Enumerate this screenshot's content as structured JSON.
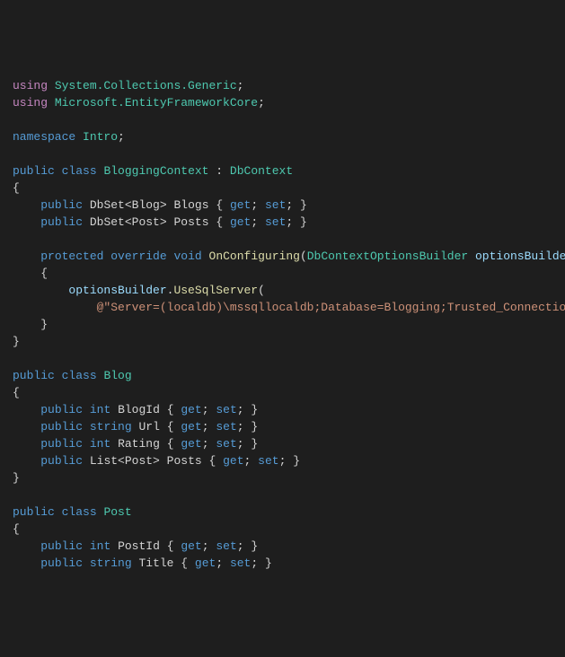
{
  "code": {
    "l1": {
      "using": "using",
      "ns": "System.Collections.Generic",
      "semi": ";"
    },
    "l2": {
      "using": "using",
      "ns": "Microsoft.EntityFrameworkCore",
      "semi": ";"
    },
    "l4": {
      "kw": "namespace",
      "name": "Intro",
      "semi": ";"
    },
    "l6": {
      "pub": "public",
      "cls": "class",
      "name": "BloggingContext",
      "colon": ":",
      "base": "DbContext"
    },
    "l7": {
      "brace": "{"
    },
    "l8": {
      "pub": "public",
      "type": "DbSet<Blog>",
      "name": "Blogs",
      "ob": "{",
      "get": "get",
      "s1": ";",
      "set": "set",
      "s2": ";",
      "cb": "}"
    },
    "l9": {
      "pub": "public",
      "type": "DbSet<Post>",
      "name": "Posts",
      "ob": "{",
      "get": "get",
      "s1": ";",
      "set": "set",
      "s2": ";",
      "cb": "}"
    },
    "l11": {
      "prot": "protected",
      "ovr": "override",
      "void": "void",
      "name": "OnConfiguring",
      "op": "(",
      "ptype": "DbContextOptionsBuilder",
      "pname": "optionsBuilder"
    },
    "l12": {
      "brace": "{"
    },
    "l13": {
      "obj": "optionsBuilder",
      "dot": ".",
      "method": "UseSqlServer",
      "op": "("
    },
    "l14": {
      "str": "@\"Server=(localdb)\\mssqllocaldb;Database=Blogging;Trusted_Connection"
    },
    "l15": {
      "brace": "}"
    },
    "l16": {
      "brace": "}"
    },
    "l18": {
      "pub": "public",
      "cls": "class",
      "name": "Blog"
    },
    "l19": {
      "brace": "{"
    },
    "l20": {
      "pub": "public",
      "type": "int",
      "name": "BlogId",
      "ob": "{",
      "get": "get",
      "s1": ";",
      "set": "set",
      "s2": ";",
      "cb": "}"
    },
    "l21": {
      "pub": "public",
      "type": "string",
      "name": "Url",
      "ob": "{",
      "get": "get",
      "s1": ";",
      "set": "set",
      "s2": ";",
      "cb": "}"
    },
    "l22": {
      "pub": "public",
      "type": "int",
      "name": "Rating",
      "ob": "{",
      "get": "get",
      "s1": ";",
      "set": "set",
      "s2": ";",
      "cb": "}"
    },
    "l23": {
      "pub": "public",
      "type": "List<Post>",
      "name": "Posts",
      "ob": "{",
      "get": "get",
      "s1": ";",
      "set": "set",
      "s2": ";",
      "cb": "}"
    },
    "l24": {
      "brace": "}"
    },
    "l26": {
      "pub": "public",
      "cls": "class",
      "name": "Post"
    },
    "l27": {
      "brace": "{"
    },
    "l28": {
      "pub": "public",
      "type": "int",
      "name": "PostId",
      "ob": "{",
      "get": "get",
      "s1": ";",
      "set": "set",
      "s2": ";",
      "cb": "}"
    },
    "l29": {
      "pub": "public",
      "type": "string",
      "name": "Title",
      "ob": "{",
      "get": "get",
      "s1": ";",
      "set": "set",
      "s2": ";",
      "cb": "}"
    }
  }
}
